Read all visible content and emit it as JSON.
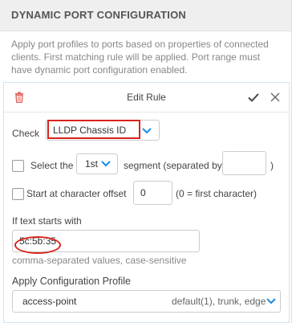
{
  "section": {
    "title": "DYNAMIC PORT CONFIGURATION",
    "description": "Apply port profiles to ports based on properties of connected clients. First matching rule will be applied. Port range must have dynamic port configuration enabled."
  },
  "editor": {
    "title": "Edit Rule",
    "check": {
      "label": "Check",
      "value": "LLDP Chassis ID"
    },
    "segment": {
      "checked": false,
      "label_before": "Select the",
      "value": "1st",
      "label_after": "segment (separated by",
      "separator_value": "",
      "label_close": ")"
    },
    "offset": {
      "checked": false,
      "label": "Start at character offset",
      "value": "0",
      "hint": "(0 = first character)"
    },
    "starts_with": {
      "label": "If text starts with",
      "value": "5c:5b:35",
      "hint": "comma-separated values, case-sensitive"
    },
    "profile": {
      "label": "Apply Configuration Profile",
      "value": "access-point",
      "detail": "default(1), trunk, edge"
    }
  },
  "colors": {
    "accent": "#1b8be0",
    "highlight": "#d9241c",
    "delete": "#e0665e"
  }
}
